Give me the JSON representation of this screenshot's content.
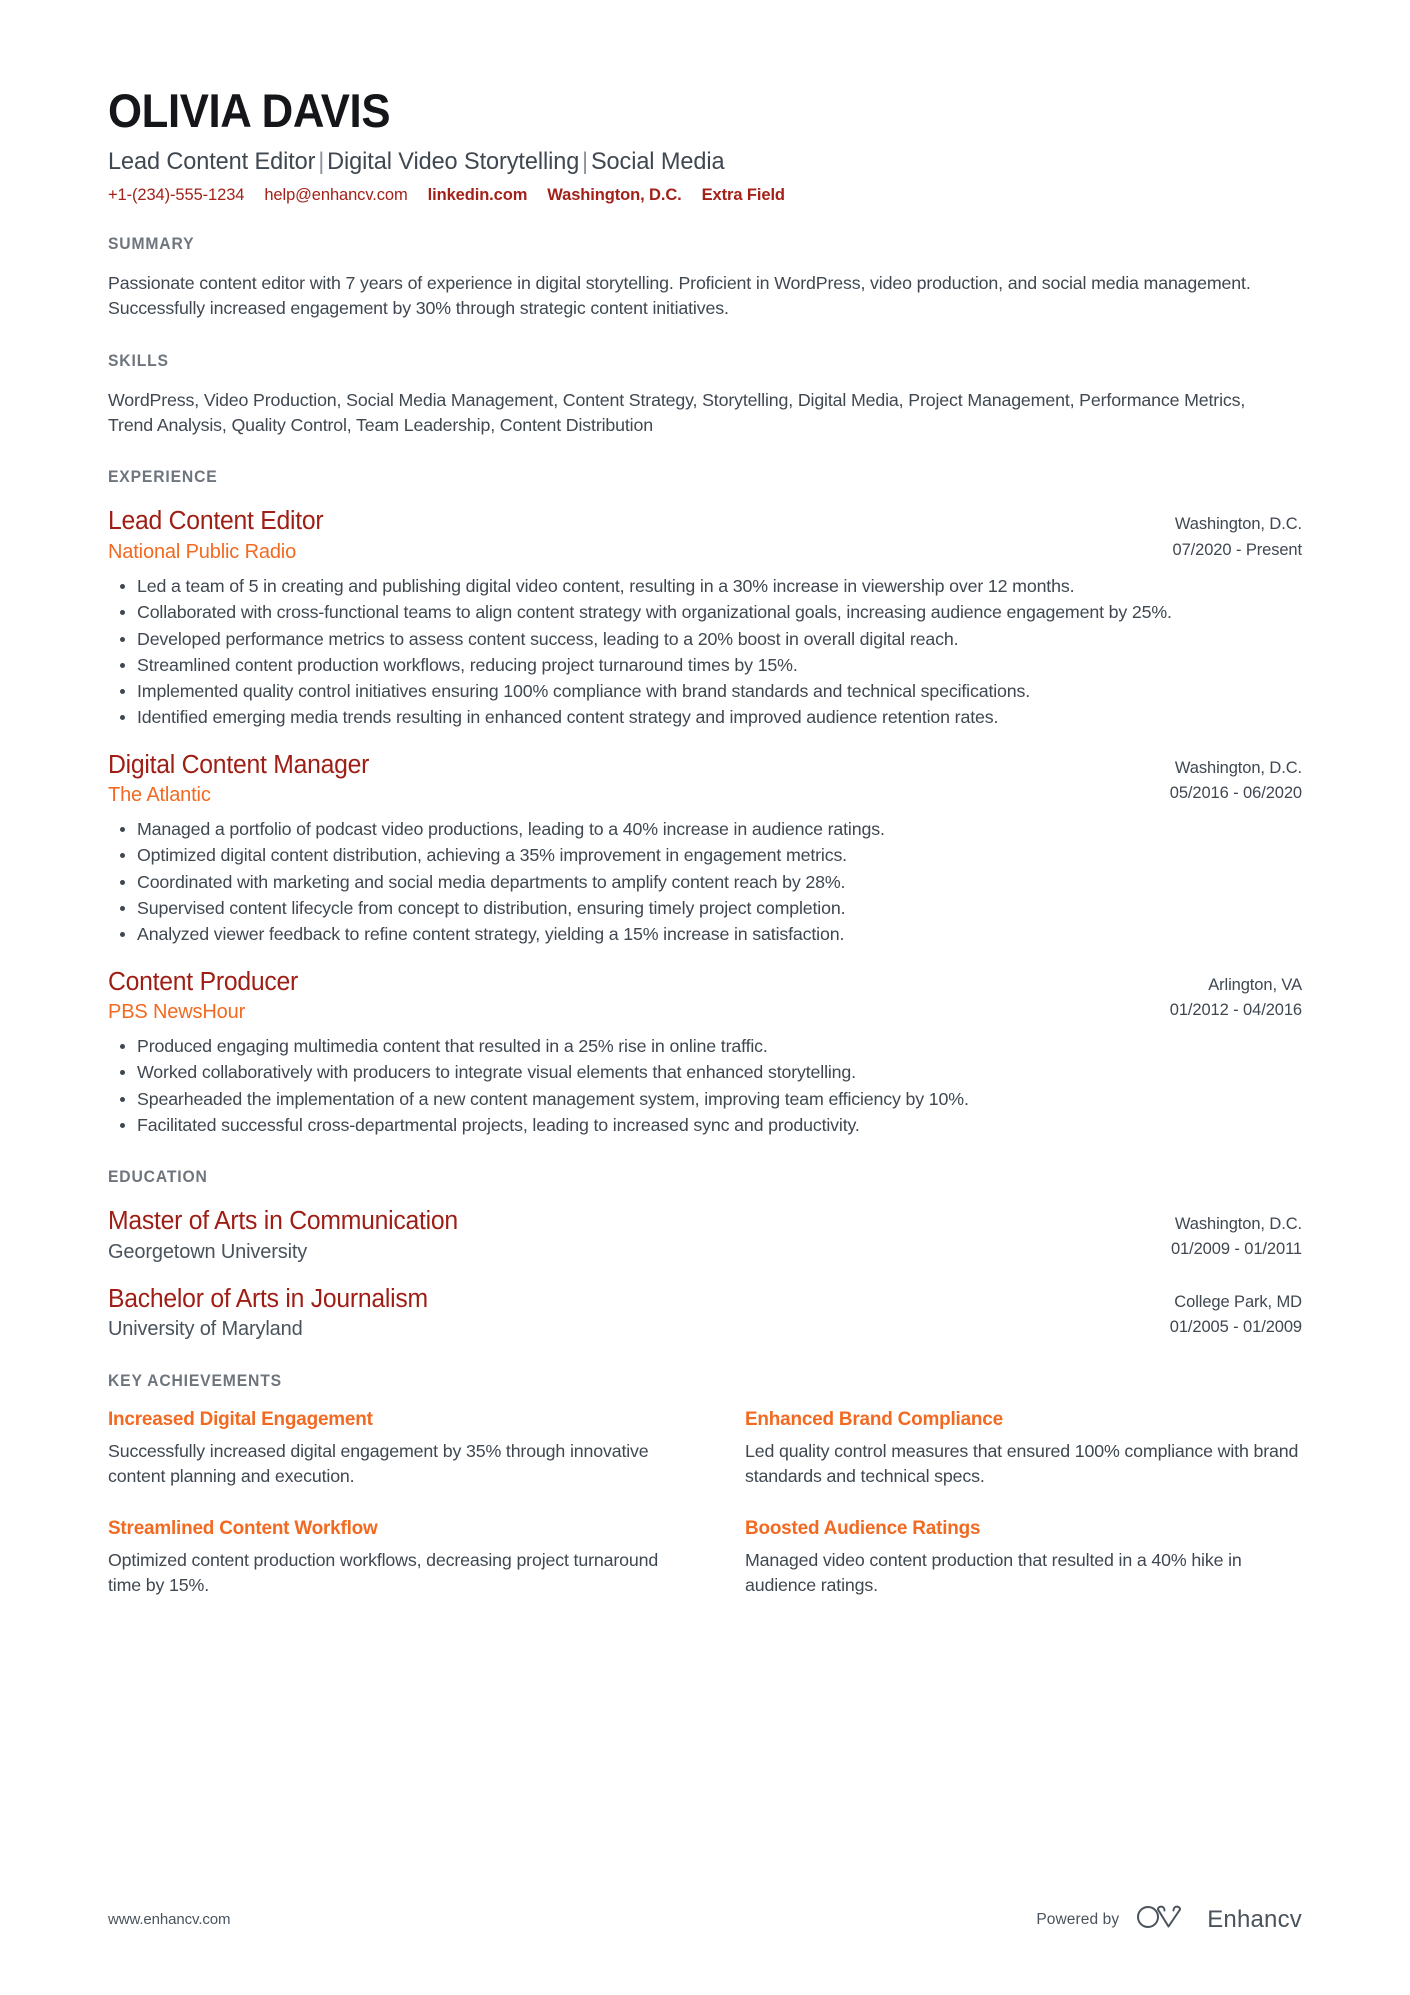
{
  "header": {
    "name": "OLIVIA DAVIS",
    "headline_parts": [
      "Lead Content Editor",
      "Digital Video Storytelling",
      "Social Media"
    ],
    "headline_separator": "|",
    "contacts": [
      {
        "name": "phone",
        "text": "+1-(234)-555-1234"
      },
      {
        "name": "email",
        "text": "help@enhancv.com"
      },
      {
        "name": "linkedin",
        "text": "linkedin.com"
      },
      {
        "name": "location",
        "text": "Washington, D.C."
      },
      {
        "name": "extra-field",
        "text": "Extra Field"
      }
    ]
  },
  "summary": {
    "title": "SUMMARY",
    "text": "Passionate content editor with 7 years of experience in digital storytelling. Proficient in WordPress, video production, and social media management. Successfully increased engagement by 30% through strategic content initiatives."
  },
  "skills": {
    "title": "SKILLS",
    "text": "WordPress, Video Production, Social Media Management, Content Strategy, Storytelling, Digital Media, Project Management, Performance Metrics, Trend Analysis, Quality Control, Team Leadership, Content Distribution"
  },
  "experience": {
    "title": "EXPERIENCE",
    "entries": [
      {
        "role": "Lead Content Editor",
        "company": "National Public Radio",
        "location": "Washington, D.C.",
        "dates": "07/2020 - Present",
        "bullets": [
          "Led a team of 5 in creating and publishing digital video content, resulting in a 30% increase in viewership over 12 months.",
          "Collaborated with cross-functional teams to align content strategy with organizational goals, increasing audience engagement by 25%.",
          "Developed performance metrics to assess content success, leading to a 20% boost in overall digital reach.",
          "Streamlined content production workflows, reducing project turnaround times by 15%.",
          "Implemented quality control initiatives ensuring 100% compliance with brand standards and technical specifications.",
          "Identified emerging media trends resulting in enhanced content strategy and improved audience retention rates."
        ]
      },
      {
        "role": "Digital Content Manager",
        "company": "The Atlantic",
        "location": "Washington, D.C.",
        "dates": "05/2016 - 06/2020",
        "bullets": [
          "Managed a portfolio of podcast video productions, leading to a 40% increase in audience ratings.",
          "Optimized digital content distribution, achieving a 35% improvement in engagement metrics.",
          "Coordinated with marketing and social media departments to amplify content reach by 28%.",
          "Supervised content lifecycle from concept to distribution, ensuring timely project completion.",
          "Analyzed viewer feedback to refine content strategy, yielding a 15% increase in satisfaction."
        ]
      },
      {
        "role": "Content Producer",
        "company": "PBS NewsHour",
        "location": "Arlington, VA",
        "dates": "01/2012 - 04/2016",
        "bullets": [
          "Produced engaging multimedia content that resulted in a 25% rise in online traffic.",
          "Worked collaboratively with producers to integrate visual elements that enhanced storytelling.",
          "Spearheaded the implementation of a new content management system, improving team efficiency by 10%.",
          "Facilitated successful cross-departmental projects, leading to increased sync and productivity."
        ]
      }
    ]
  },
  "education": {
    "title": "EDUCATION",
    "entries": [
      {
        "degree": "Master of Arts in Communication",
        "school": "Georgetown University",
        "location": "Washington, D.C.",
        "dates": "01/2009 - 01/2011"
      },
      {
        "degree": "Bachelor of Arts in Journalism",
        "school": "University of Maryland",
        "location": "College Park, MD",
        "dates": "01/2005 - 01/2009"
      }
    ]
  },
  "key_achievements": {
    "title": "KEY ACHIEVEMENTS",
    "items": [
      {
        "title": "Increased Digital Engagement",
        "description": "Successfully increased digital engagement by 35% through innovative content planning and execution."
      },
      {
        "title": "Enhanced Brand Compliance",
        "description": "Led quality control measures that ensured 100% compliance with brand standards and technical specs."
      },
      {
        "title": "Streamlined Content Workflow",
        "description": "Optimized content production workflows, decreasing project turnaround time by 15%."
      },
      {
        "title": "Boosted Audience Ratings",
        "description": "Managed video content production that resulted in a 40% hike in audience ratings."
      }
    ]
  },
  "footer": {
    "url": "www.enhancv.com",
    "powered_by": "Powered by",
    "brand": "Enhancv"
  },
  "colors": {
    "name": "#14161a",
    "headline": "#3f4750",
    "contact": "#a32118",
    "section_title": "#6e757c",
    "entry_title": "#9e1d14",
    "company": "#f26a21",
    "achievement_title": "#f26a21",
    "body": "#3f4750"
  }
}
